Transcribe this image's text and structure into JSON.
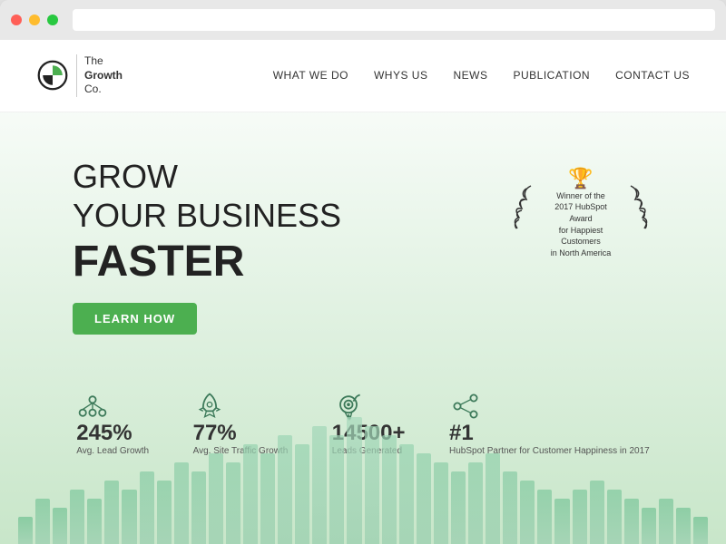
{
  "browser": {
    "dots": [
      "red",
      "yellow",
      "green"
    ]
  },
  "header": {
    "logo_name": "The Growth Co.",
    "nav_items": [
      "WHAT WE DO",
      "WHYS US",
      "NEWS",
      "PUBLICATION",
      "CONTACT US"
    ]
  },
  "hero": {
    "title_line1": "GROW",
    "title_line2": "YOUR BUSINESS",
    "title_line3": "FASTER",
    "cta_button": "LEARN HOW",
    "award_line1": "Winner of the",
    "award_line2": "2017 HubSpot Award",
    "award_line3": "for Happiest Customers",
    "award_line4": "in North America"
  },
  "stats": [
    {
      "number": "245%",
      "label": "Avg. Lead Growth",
      "icon": "network"
    },
    {
      "number": "77%",
      "label": "Avg. Site Traffic Growth",
      "icon": "rocket"
    },
    {
      "number": "14500+",
      "label": "Leads Generated",
      "icon": "target"
    },
    {
      "number": "#1",
      "label": "HubSpot Partner for Customer Happiness in 2017",
      "icon": "share"
    }
  ],
  "bars": [
    3,
    5,
    4,
    6,
    5,
    7,
    6,
    8,
    7,
    9,
    8,
    10,
    9,
    11,
    10,
    12,
    11,
    13,
    12,
    14,
    13,
    12,
    11,
    10,
    9,
    8,
    9,
    10,
    8,
    7,
    6,
    5,
    6,
    7,
    6,
    5,
    4,
    5,
    4,
    3
  ],
  "colors": {
    "green_accent": "#4caf50",
    "brand_dark": "#333333",
    "bar_color": "#5b9e7a"
  }
}
